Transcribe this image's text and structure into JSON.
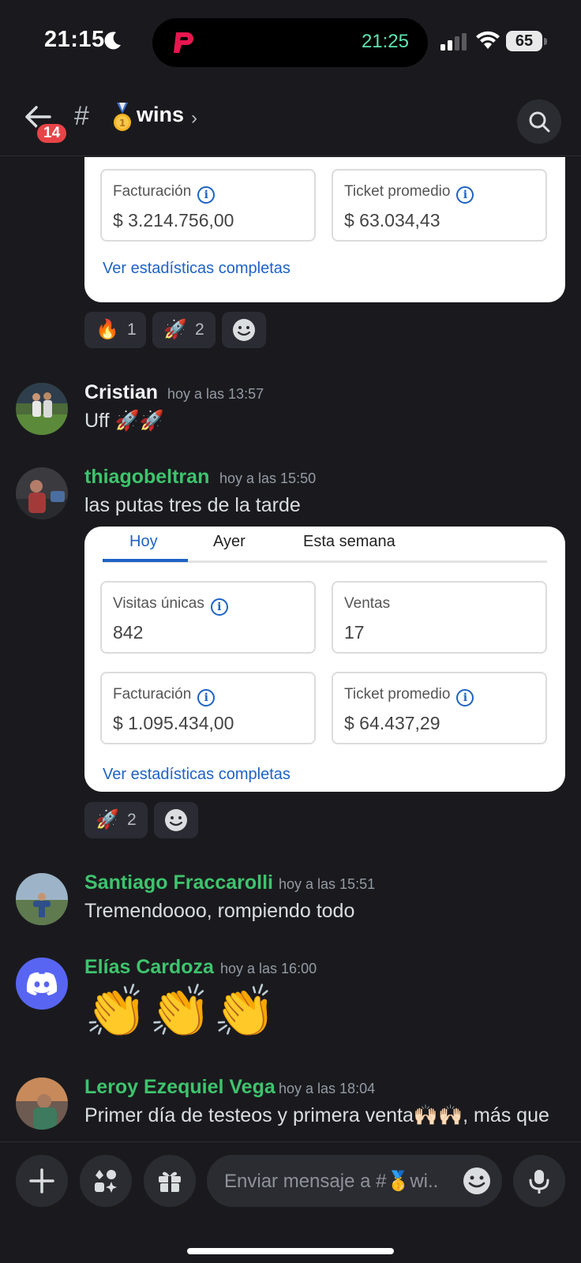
{
  "status_bar": {
    "time": "21:15",
    "island_time": "21:25",
    "battery": "65"
  },
  "header": {
    "unread_badge": "14",
    "channel_prefix": "#",
    "channel_name": "wins",
    "channel_emoji": "1st-place-medal-icon"
  },
  "card1": {
    "stats": [
      {
        "label": "Facturación",
        "value": "$ 3.214.756,00",
        "info": true
      },
      {
        "label": "Ticket promedio",
        "value": "$ 63.034,43",
        "info": true
      }
    ],
    "link": "Ver estadísticas completas",
    "reactions": [
      {
        "emoji": "🔥",
        "count": "1"
      },
      {
        "emoji": "🚀",
        "count": "2"
      }
    ]
  },
  "messages": [
    {
      "author": "Cristian",
      "time": "hoy a las 13:57",
      "text": "Uff 🚀🚀",
      "author_color": "white"
    },
    {
      "author": "thiagobeltran",
      "time": "hoy a las 15:50",
      "text": "las putas tres de la tarde",
      "author_color": "green"
    },
    {
      "author": "Santiago Fraccarolli",
      "time": "hoy a las 15:51",
      "text": "Tremendoooo, rompiendo todo",
      "author_color": "green"
    },
    {
      "author": "Elías Cardoza",
      "time": "hoy a las 16:00",
      "text": "👏👏👏",
      "author_color": "green"
    },
    {
      "author": "Leroy Ezequiel Vega",
      "time": "hoy a las 18:04",
      "text": "Primer día de testeos y primera venta🙌🏻🙌🏻, más que",
      "author_color": "green"
    }
  ],
  "card2": {
    "tabs": [
      "Hoy",
      "Ayer",
      "Esta semana"
    ],
    "active_tab": "Hoy",
    "stats": [
      {
        "label": "Visitas únicas",
        "value": "842",
        "info": true
      },
      {
        "label": "Ventas",
        "value": "17",
        "info": false
      },
      {
        "label": "Facturación",
        "value": "$ 1.095.434,00",
        "info": true
      },
      {
        "label": "Ticket promedio",
        "value": "$ 64.437,29",
        "info": true
      }
    ],
    "link": "Ver estadísticas completas",
    "reactions": [
      {
        "emoji": "🚀",
        "count": "2"
      }
    ]
  },
  "composer": {
    "placeholder": "Enviar mensaje a #🥇wi.."
  },
  "colors": {
    "background": "#1a1a1e",
    "green_name": "#3ec46d",
    "link_blue": "#1e63c5",
    "badge_red": "#e84347",
    "discord_blurple": "#5865f2"
  }
}
